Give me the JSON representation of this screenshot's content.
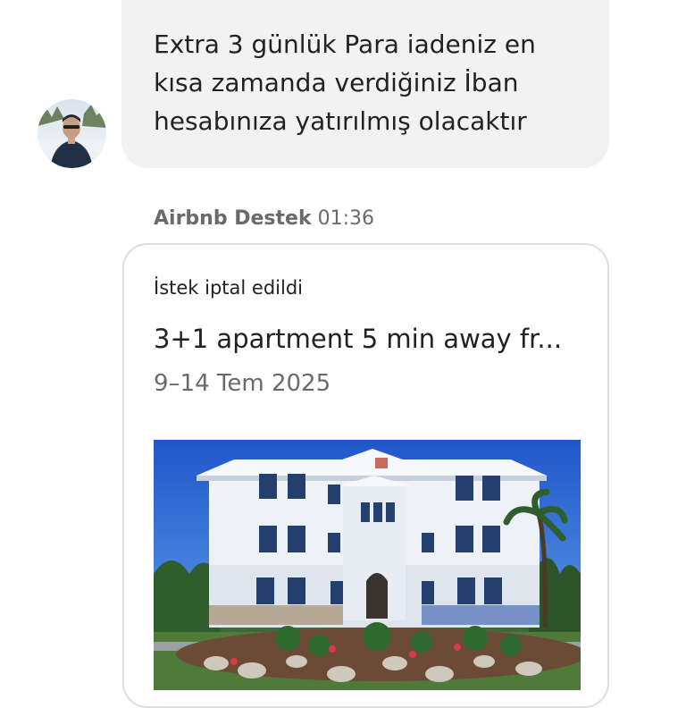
{
  "message": {
    "text": "Extra 3 günlük Para iadeniz en\nkısa zamanda verdiğiniz İban\nhesabınıza yatırılmış olacaktır"
  },
  "system_message": {
    "sender": "Airbnb Destek",
    "time": "01:36"
  },
  "reservation_card": {
    "status": "İstek iptal edildi",
    "title": "3+1 apartment 5 min away fr...",
    "dates": "9–14 Tem 2025"
  },
  "colors": {
    "bubble_bg": "#f2f2f2",
    "text_primary": "#222222",
    "text_secondary": "#6a6a6a",
    "card_border": "#dddddd"
  }
}
